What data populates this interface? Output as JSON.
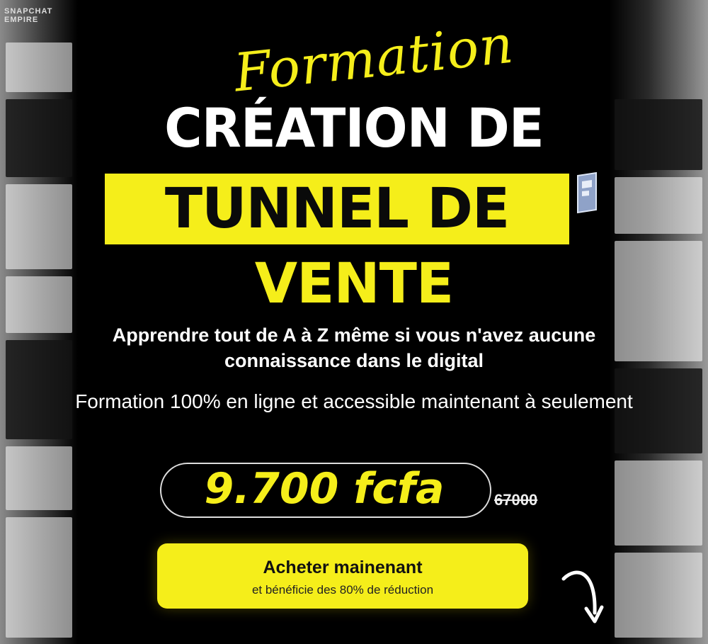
{
  "header": {
    "script_title": "Formation",
    "line1": "CRÉATION DE",
    "line2": "TUNNEL DE",
    "line3": "VENTE"
  },
  "description": {
    "line1": "Apprendre tout de A à Z même si vous n'avez aucune connaissance dans le digital",
    "line2": "Formation 100% en ligne et accessible maintenant à seulement"
  },
  "pricing": {
    "price": "9.700  fcfa",
    "old_price": "67000"
  },
  "cta": {
    "label": "Acheter mainenant",
    "sublabel": "et bénéficie des 80% de réduction"
  },
  "side_left": {
    "brand": "SNAPCHAT EMPIRE"
  },
  "colors": {
    "accent": "#f5ee1a",
    "background": "#000000",
    "text": "#ffffff"
  },
  "icons": {
    "arrow": "curved-arrow-down-icon",
    "badge": "funnel-logo-icon"
  }
}
